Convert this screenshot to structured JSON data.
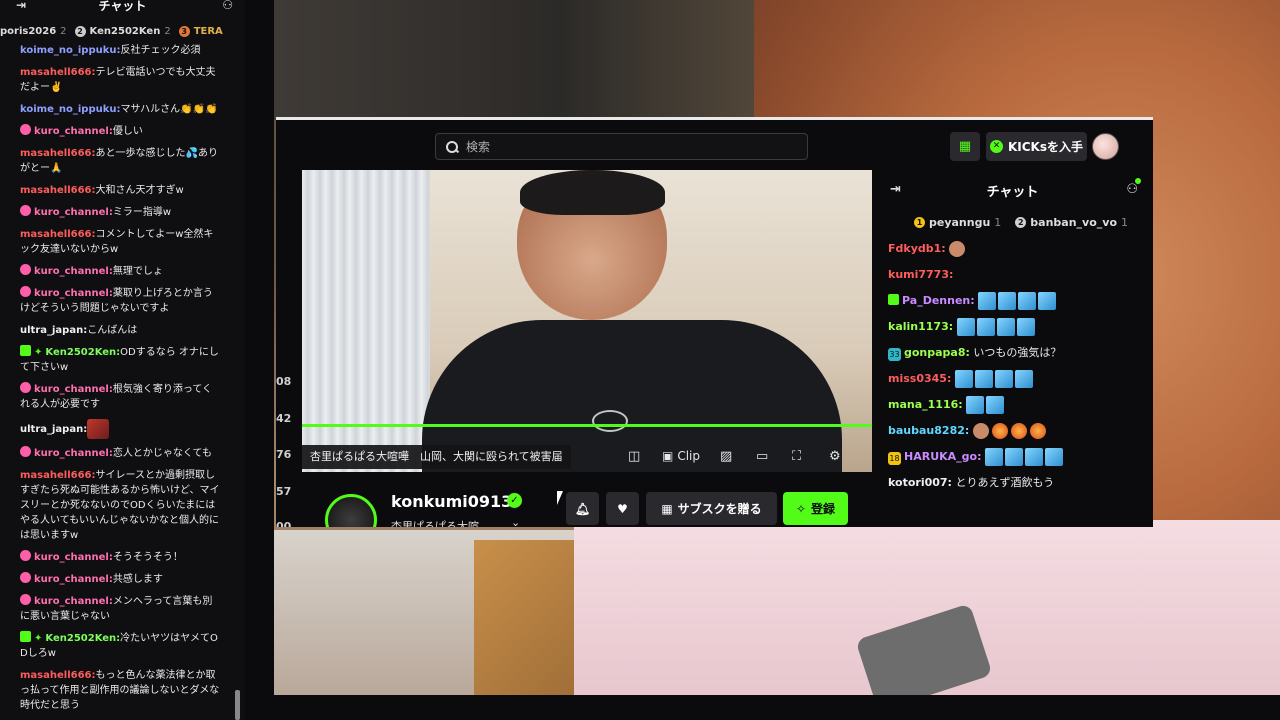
{
  "left_chat": {
    "title": "チャット",
    "gifters": [
      {
        "name": "poris2026",
        "count": "2"
      },
      {
        "name": "Ken2502Ken",
        "count": "2"
      },
      {
        "name": "TERA",
        "count": ""
      }
    ],
    "messages": [
      {
        "user": "koime_no_ippuku:",
        "text": "反社チェック必須"
      },
      {
        "user": "masahell666:",
        "text": "テレビ電話いつでも大丈夫だよー✌️"
      },
      {
        "user": "koime_no_ippuku:",
        "text": "マサハルさん👏👏👏"
      },
      {
        "user": "kuro_channel:",
        "text": "優しい"
      },
      {
        "user": "masahell666:",
        "text": "あと一歩な感じした💦ありがとー🙏"
      },
      {
        "user": "masahell666:",
        "text": "大和さん天才すぎw"
      },
      {
        "user": "kuro_channel:",
        "text": "ミラー指導w"
      },
      {
        "user": "masahell666:",
        "text": "コメントしてよーw全然キック友達いないからw"
      },
      {
        "user": "kuro_channel:",
        "text": "無理でしょ"
      },
      {
        "user": "kuro_channel:",
        "text": "薬取り上げろとか言うけどそういう問題じゃないですよ"
      },
      {
        "user": "ultra_japan:",
        "text": "こんばんは"
      },
      {
        "user": "Ken2502Ken:",
        "text": "ODするなら オナにして下さいw"
      },
      {
        "user": "kuro_channel:",
        "text": "根気強く寄り添ってくれる人が必要です"
      },
      {
        "user": "ultra_japan:",
        "text": ""
      },
      {
        "user": "kuro_channel:",
        "text": "恋人とかじゃなくても"
      },
      {
        "user": "masahell666:",
        "text": "サイレースとか過剰摂取しすぎたら死ぬ可能性あるから怖いけど、マイスリーとか死なないのでODくらいたまにはやる人いてもいいんじゃないかなと個人的には思いますw"
      },
      {
        "user": "kuro_channel:",
        "text": "そうそうそう！"
      },
      {
        "user": "kuro_channel:",
        "text": "共感します"
      },
      {
        "user": "kuro_channel:",
        "text": "メンヘラって言葉も別に悪い言葉じゃない"
      },
      {
        "user": "Ken2502Ken:",
        "text": "冷たいヤツはヤメてODしろw"
      },
      {
        "user": "masahell666:",
        "text": "もっと色んな薬法律とか取っ払って作用と副作用の議論しないとダメな時代だと思う"
      }
    ]
  },
  "overlay": {
    "search": {
      "placeholder": "検索"
    },
    "kicks_button": "KICKsを入手",
    "player": {
      "title": "杏里ぱるぱる大喧嘩　山岡、大関に殴られて被害届",
      "clip_label": "Clip"
    },
    "stub_numbers": [
      "08",
      "42",
      "76",
      "57",
      "00"
    ],
    "channel": {
      "name": "konkumi0913",
      "subtitle": "杏里ぱるぱる大喧...",
      "subs_button": "サブスクを贈る",
      "follow_button": "登録"
    },
    "chat": {
      "title": "チャット",
      "gifters": [
        {
          "rank": "1",
          "name": "peyanngu",
          "count": "1"
        },
        {
          "rank": "2",
          "name": "banban_vo_vo",
          "count": "1"
        }
      ],
      "messages": [
        {
          "user": "Fdkydb1:",
          "text": ""
        },
        {
          "user": "kumi7773:",
          "text": ""
        },
        {
          "user": "Pa_Dennen:",
          "text": ""
        },
        {
          "user": "kalin1173:",
          "text": ""
        },
        {
          "user": "gonpapa8:",
          "text": "いつもの強気は？"
        },
        {
          "user": "miss0345:",
          "text": ""
        },
        {
          "user": "mana_1116:",
          "text": ""
        },
        {
          "user": "baubau8282:",
          "text": ""
        },
        {
          "user": "HARUKA_go:",
          "text": ""
        },
        {
          "user": "kotori007:",
          "text": "とりあえず酒飲もう"
        }
      ],
      "badges": {
        "gonpapa8": "33",
        "HARUKA_go": "18"
      }
    }
  }
}
